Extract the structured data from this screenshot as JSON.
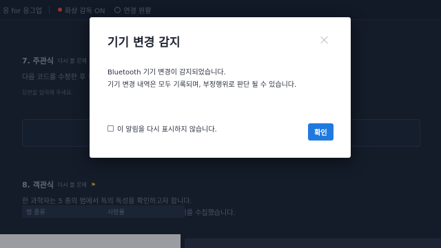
{
  "topbar": {
    "left_text": "응 for 응그업",
    "recording_label": "화상 감독 ON",
    "network_label": "연결 원활"
  },
  "background": {
    "q7": {
      "number": "7. 주관식",
      "tag": "다시 볼 문제",
      "text": "다음 코드를 수정한 후 결과 값을 입력하세요.",
      "answer_label": "답변을 입력해 주세요."
    },
    "q8": {
      "number": "8. 객관식",
      "tag": "다시 볼 문제",
      "text_line1": "한 과학자는 5 종의 범에서 독의 독성을 확인하고자 합니다.",
      "text_line2": "그는 각 뱀 종에 물린 사람을 (또는 사망률)에 대한 데이터를 수집했습니다.",
      "table_headers": [
        "뱀 종류",
        "사망률"
      ]
    }
  },
  "modal": {
    "title": "기기 변경 감지",
    "message_line1": "Bluetooth 기기 변경이 감지되었습니다.",
    "message_line2": "기기 변경 내역은 모두 기록되며, 부정행위로 판단 될 수 있습니다.",
    "checkbox_label": "이 알림을 다시 표시하지 않습니다.",
    "checkbox_checked": false,
    "confirm_label": "확인",
    "confirm_color": "#1f7ae0"
  }
}
